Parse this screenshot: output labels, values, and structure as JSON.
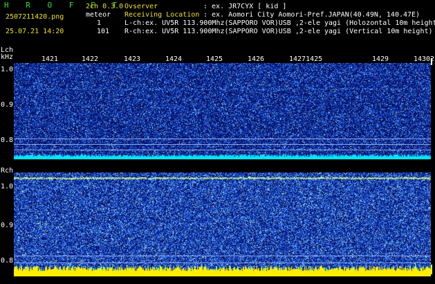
{
  "header": {
    "app_title": "H R O F F T",
    "mode": "2ch 0.3.0",
    "filename": "2507211420.png",
    "event_type": "meteor",
    "datetime": "25.07.21 14:20",
    "count_l": "1",
    "count_r": "101",
    "observer_label": "Ovserver",
    "observer_value": ": ex. JR7CYX [ kid ]",
    "location_label": "Receiving Location",
    "location_value": ": ex. Aomori City Aomori-Pref.JAPAN(40.49N, 140.47E)",
    "lch_info": "L-ch:ex. UV5R 113.900Mhz(SAPPORO VOR)USB ,2-ele yagi (Holozontal 10m height",
    "rch_info": "R-ch:ex. UV5R 113.900Mhz(SAPPORO VOR)USB ,2-ele yagi (Vertical 10m height)"
  },
  "lch_panel": {
    "channel_label": "Lch",
    "unit_label": "kHz",
    "y_ticks": [
      "1.0",
      "0.9",
      "0.8"
    ],
    "time_ticks": [
      "1421",
      "1422",
      "1423",
      "1424",
      "1425",
      "1426",
      "14271425",
      "1429",
      "1430",
      "2"
    ]
  },
  "rch_panel": {
    "channel_label": "Rch",
    "y_ticks": [
      "1.0",
      "0.9",
      "0.8"
    ]
  },
  "colors": {
    "header_green": "#33e233",
    "header_yellow": "#f0e020",
    "background": "#000000",
    "spectrogram_low": "#0a1a78",
    "spectrogram_noise": "#1e6fff",
    "signal_cyan": "#00e5ff",
    "signal_yellow": "#ffee00"
  }
}
